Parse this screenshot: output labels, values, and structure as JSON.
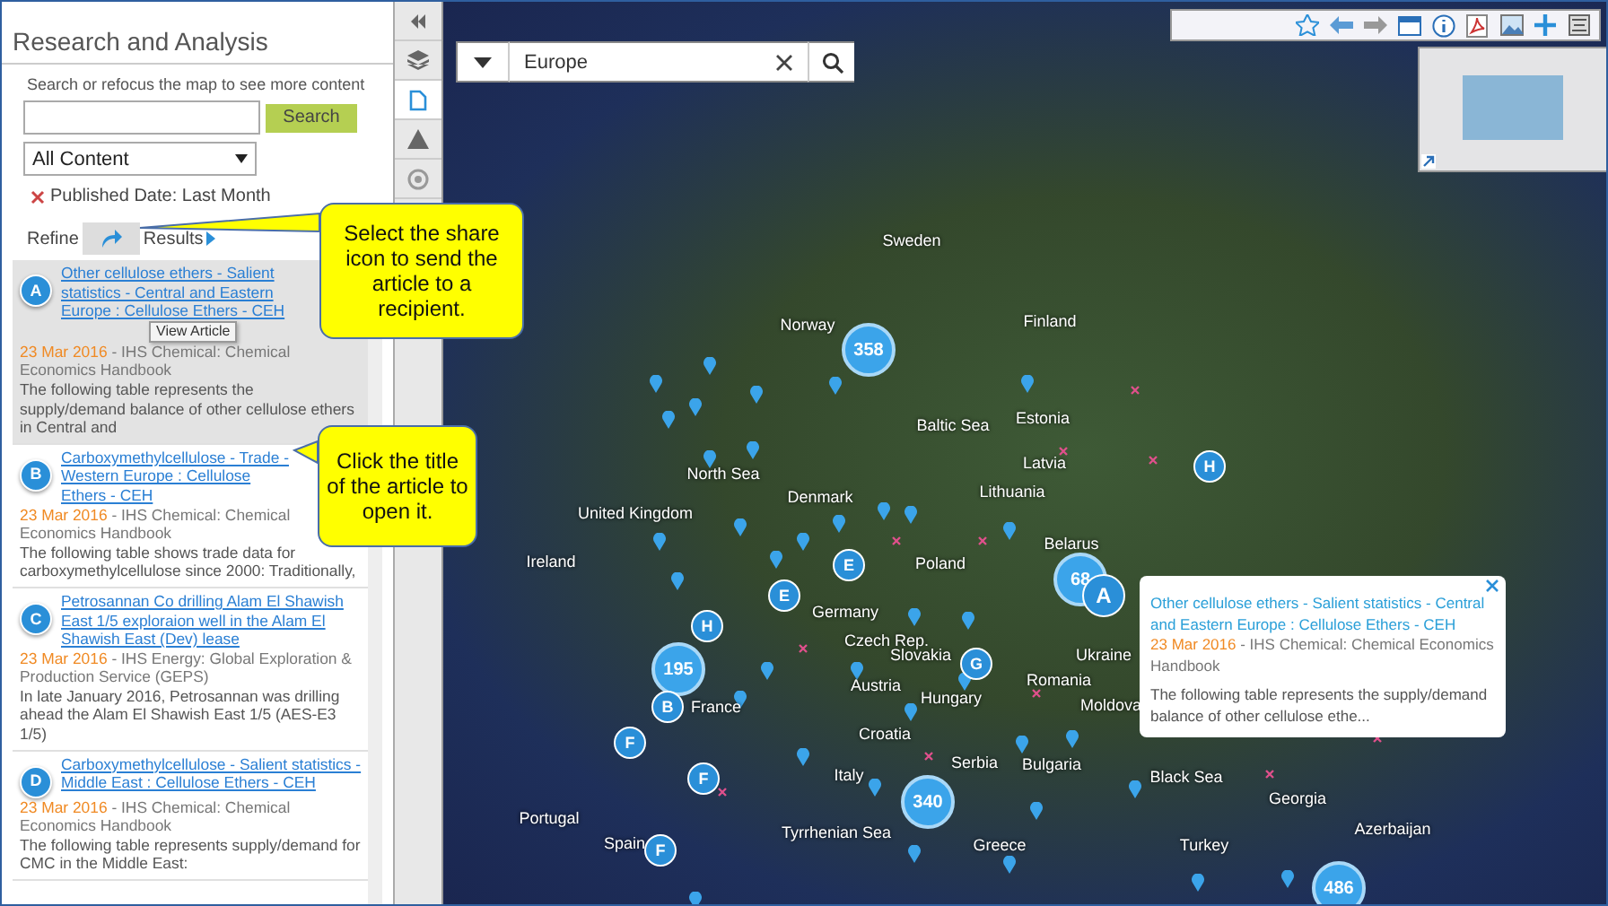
{
  "panel": {
    "title": "Research and Analysis",
    "hint": "Search or refocus the map to see more content",
    "search_button": "Search",
    "filter_select": "All Content",
    "active_filter": "Published Date: Last Month",
    "refine_label": "Refine",
    "results_label": "Results"
  },
  "side_tools": [
    {
      "kind": "collapse",
      "selected": false
    },
    {
      "kind": "layers",
      "selected": false
    },
    {
      "kind": "document",
      "selected": true
    },
    {
      "kind": "warning",
      "selected": false
    },
    {
      "kind": "target",
      "selected": false
    }
  ],
  "articles": [
    {
      "letter": "A",
      "title": "Other cellulose ethers - Salient statistics - Central and Eastern Europe : Cellulose Ethers - CEH",
      "date": "23 Mar 2016",
      "source": " - IHS Chemical: Chemical Economics Handbook",
      "snippet": "The following table represents the supply/demand balance of other cellulose ethers in Central and",
      "selected": true
    },
    {
      "letter": "B",
      "title": "Carboxymethylcellulose - Trade - Western Europe : Cellulose Ethers - CEH",
      "date": "23 Mar 2016",
      "source": " - IHS Chemical: Chemical Economics Handbook",
      "snippet": "The following table shows trade data for carboxymethylcellulose since 2000: Traditionally,",
      "selected": false
    },
    {
      "letter": "C",
      "title": "Petrosannan Co drilling Alam El Shawish East 1/5 exploraion well in the Alam El Shawish East (Dev) lease",
      "date": "23 Mar 2016",
      "source": " - IHS Energy: Global Exploration & Production Service (GEPS)",
      "snippet": "In late January 2016, Petrosannan was drilling ahead the Alam El Shawish East 1/5 (AES-E3 1/5)",
      "selected": false
    },
    {
      "letter": "D",
      "title": "Carboxymethylcellulose - Salient statistics - Middle East : Cellulose Ethers - CEH",
      "date": "23 Mar 2016",
      "source": " - IHS Chemical: Chemical Economics Handbook",
      "snippet": "The following table represents supply/demand for CMC in the Middle East:",
      "selected": false
    }
  ],
  "tooltip": "View Article",
  "callouts": [
    {
      "text": "Select the share icon to send the article to a recipient."
    },
    {
      "text": "Click the title of the article to open it."
    }
  ],
  "map": {
    "search_value": "Europe",
    "labels": [
      "Sweden",
      "Norway",
      "Finland",
      "Estonia",
      "Baltic Sea",
      "Latvia",
      "Lithuania",
      "North Sea",
      "Denmark",
      "United Kingdom",
      "Ireland",
      "Poland",
      "Belarus",
      "Germany",
      "Ukraine",
      "Czech Rep.",
      "Slovakia",
      "Austria",
      "Hungary",
      "Romania",
      "France",
      "Moldova",
      "Croatia",
      "Serbia",
      "Italy",
      "Bulgaria",
      "Black Sea",
      "Portugal",
      "Spain",
      "Tyrrhenian Sea",
      "Greece",
      "Turkey",
      "Georgia",
      "Azerbaijan"
    ],
    "clusters": [
      "358",
      "68",
      "195",
      "340",
      "486"
    ],
    "pins": [
      "A",
      "B",
      "E",
      "E",
      "F",
      "F",
      "F",
      "G",
      "H",
      "H"
    ],
    "popup": {
      "title": "Other cellulose ethers - Salient statistics - Central and Eastern Europe : Cellulose Ethers - CEH",
      "date": "23 Mar 2016",
      "source": " - IHS Chemical: Chemical Economics Handbook",
      "snippet": "The following table represents the supply/demand balance of other cellulose ethe..."
    }
  }
}
